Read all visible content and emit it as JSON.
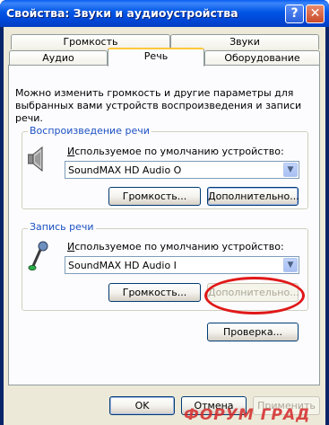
{
  "window": {
    "title": "Свойства: Звуки и аудиоустройства",
    "help_label": "?",
    "close_label": "✕"
  },
  "tabs": {
    "row1": [
      "Громкость",
      "Звуки"
    ],
    "row2": [
      "Аудио",
      "Речь",
      "Оборудование"
    ],
    "active": "Речь"
  },
  "description": "Можно изменить громкость и другие параметры для выбранных вами устройств воспроизведения и записи речи.",
  "playback": {
    "group_title": "Воспроизведение речи",
    "device_label_u": "И",
    "device_label_rest": "спользуемое по умолчанию устройство:",
    "device_value": "SoundMAX HD Audio O",
    "volume_button": "Громкость...",
    "advanced_button": "Дополнительно..."
  },
  "recording": {
    "group_title": "Запись речи",
    "device_label_u": "И",
    "device_label_rest": "спользуемое по умолчанию устройство:",
    "device_value": "SoundMAX HD Audio I",
    "volume_button": "Громкость...",
    "advanced_button": "Дополнительно..."
  },
  "test_button": "Проверка...",
  "footer": {
    "ok": "OK",
    "cancel": "Отмена",
    "apply": "Применить"
  },
  "watermark": "ФОРУМ ГРАД",
  "colors": {
    "titlebar": "#0055e6",
    "group_title": "#1c51c3",
    "highlight_oval": "#e01818"
  },
  "icons": {
    "speaker": "speaker-icon",
    "microphone": "microphone-icon",
    "dropdown": "chevron-down-icon"
  }
}
